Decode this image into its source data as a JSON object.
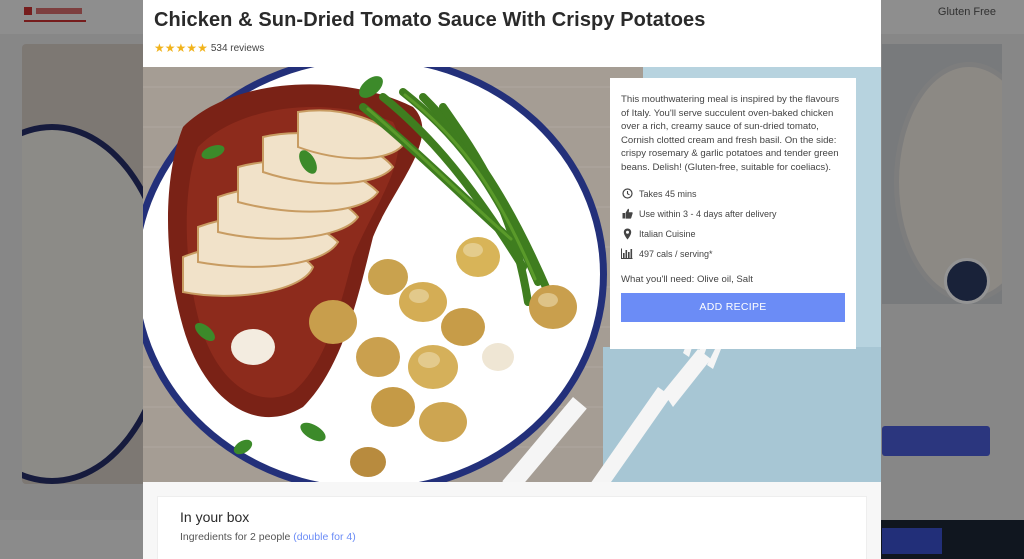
{
  "background": {
    "nav_right": "Gluten Free"
  },
  "modal": {
    "close_glyph": "✖",
    "title": "Chicken & Sun-Dried Tomato Sauce With Crispy Potatoes",
    "rating": {
      "stars": 5,
      "reviews": "534 reviews"
    },
    "description": "This mouthwatering meal is inspired by the flavours of Italy. You'll serve succulent oven-baked chicken over a rich, creamy sauce of sun-dried tomato, Cornish clotted cream and fresh basil. On the side: crispy rosemary & garlic potatoes and tender green beans. Delish! (Gluten-free, suitable for coeliacs).",
    "meta": {
      "time": "Takes 45 mins",
      "use_within": "Use within 3 - 4 days after delivery",
      "cuisine": "Italian Cuisine",
      "calories": "497 cals / serving*"
    },
    "need": "What you'll need: Olive oil, Salt",
    "add_button": "ADD RECIPE",
    "box": {
      "title": "In your box",
      "ingredients": "Ingredients for 2 people",
      "double_link": "(double for 4)"
    }
  },
  "icons": {
    "close": "close-icon",
    "star": "star-icon",
    "time": "clock-icon",
    "use_within": "thumbs-up-icon",
    "cuisine": "map-pin-icon",
    "calories": "bar-chart-icon"
  },
  "colors": {
    "accent_button": "#6b8cf6",
    "star": "#f1b31c",
    "link": "#6b8cf6",
    "title": "#2a2a2a"
  }
}
